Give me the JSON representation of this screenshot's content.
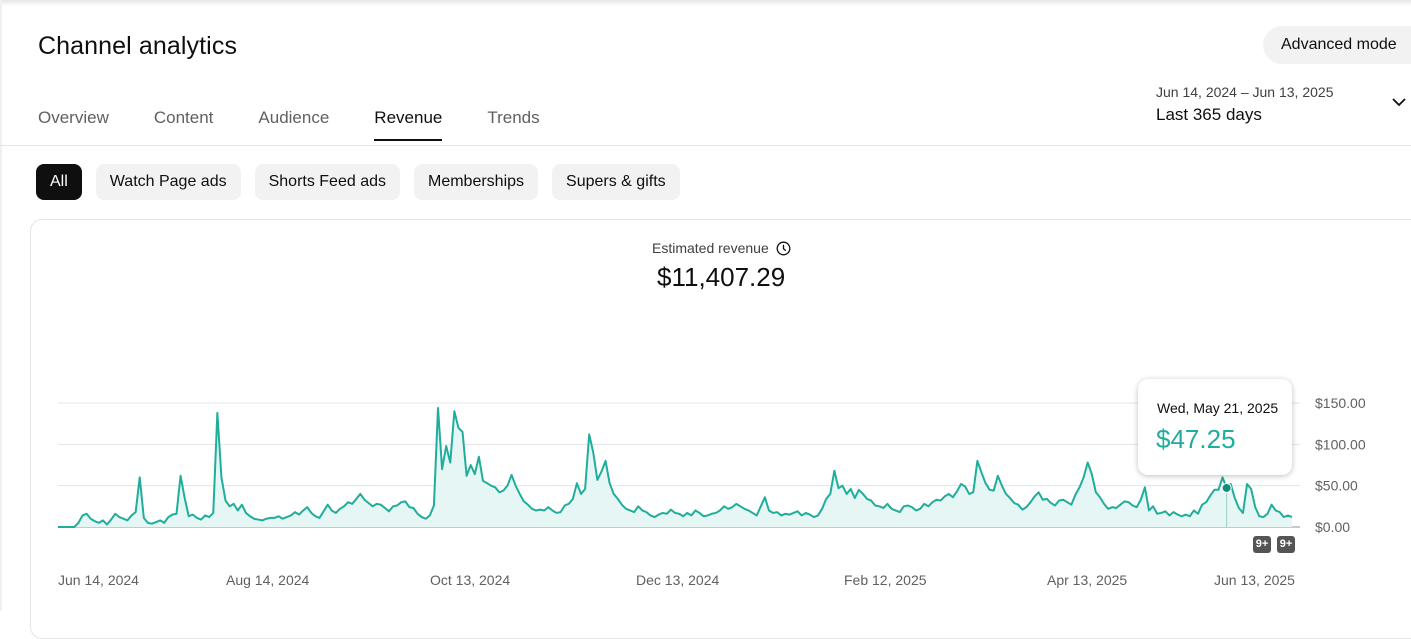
{
  "header": {
    "title": "Channel analytics",
    "advanced_mode_label": "Advanced mode"
  },
  "tabs": [
    {
      "label": "Overview"
    },
    {
      "label": "Content"
    },
    {
      "label": "Audience"
    },
    {
      "label": "Revenue",
      "active": true
    },
    {
      "label": "Trends"
    }
  ],
  "date_range": {
    "dates": "Jun 14, 2024 – Jun 13, 2025",
    "period": "Last 365 days"
  },
  "filter_chips": [
    {
      "label": "All",
      "active": true
    },
    {
      "label": "Watch Page ads"
    },
    {
      "label": "Shorts Feed ads"
    },
    {
      "label": "Memberships"
    },
    {
      "label": "Supers & gifts"
    }
  ],
  "metric": {
    "label": "Estimated revenue",
    "value": "$11,407.29",
    "info_icon": "clock-icon"
  },
  "tooltip": {
    "date": "Wed, May 21, 2025",
    "value": "$47.25"
  },
  "badges": [
    "9+",
    "9+"
  ],
  "colors": {
    "series": "#1fae9b",
    "fill": "#e6f6f4",
    "active_chip": "#0f0f0f",
    "chip": "#f2f2f2"
  },
  "chart_data": {
    "type": "area",
    "title": "Estimated revenue",
    "x_start": "Jun 14, 2024",
    "x_end": "Jun 13, 2025",
    "x_ticks": [
      "Jun 14, 2024",
      "Aug 14, 2024",
      "Oct 13, 2024",
      "Dec 13, 2024",
      "Feb 12, 2025",
      "Apr 13, 2025",
      "Jun 13, 2025"
    ],
    "y_ticks": [
      "$0.00",
      "$50.00",
      "$100.00",
      "$150.00"
    ],
    "ylim": [
      0,
      150
    ],
    "grid": true,
    "highlight": {
      "date": "May 21, 2025",
      "value": 47.25
    },
    "series": [
      {
        "values": [
          0,
          0,
          0,
          0,
          0,
          5,
          14,
          16,
          10,
          7,
          5,
          8,
          3,
          9,
          16,
          12,
          10,
          8,
          14,
          18,
          60,
          11,
          5,
          4,
          6,
          8,
          5,
          12,
          15,
          16,
          62,
          35,
          13,
          15,
          11,
          9,
          14,
          12,
          17,
          138,
          60,
          32,
          25,
          28,
          20,
          27,
          17,
          13,
          10,
          9,
          8,
          10,
          11,
          11,
          13,
          10,
          12,
          14,
          18,
          15,
          20,
          24,
          17,
          13,
          11,
          19,
          27,
          20,
          17,
          22,
          25,
          30,
          28,
          34,
          40,
          33,
          29,
          25,
          28,
          27,
          23,
          19,
          25,
          26,
          30,
          31,
          24,
          23,
          16,
          12,
          10,
          14,
          26,
          144,
          70,
          98,
          78,
          140,
          120,
          115,
          62,
          75,
          64,
          85,
          56,
          53,
          50,
          48,
          42,
          44,
          50,
          63,
          50,
          40,
          31,
          27,
          22,
          20,
          21,
          20,
          24,
          20,
          17,
          18,
          26,
          28,
          34,
          53,
          40,
          46,
          112,
          90,
          57,
          67,
          80,
          53,
          40,
          34,
          27,
          22,
          20,
          18,
          25,
          20,
          18,
          14,
          12,
          15,
          17,
          16,
          21,
          17,
          16,
          13,
          17,
          14,
          20,
          17,
          13,
          14,
          16,
          17,
          20,
          25,
          22,
          24,
          28,
          25,
          22,
          20,
          17,
          14,
          25,
          36,
          20,
          17,
          18,
          14,
          16,
          15,
          17,
          19,
          14,
          17,
          15,
          12,
          14,
          22,
          34,
          40,
          68,
          47,
          50,
          40,
          46,
          35,
          45,
          40,
          34,
          32,
          26,
          25,
          23,
          28,
          22,
          20,
          18,
          25,
          26,
          24,
          20,
          22,
          28,
          25,
          30,
          33,
          32,
          37,
          40,
          36,
          43,
          52,
          49,
          40,
          42,
          80,
          66,
          53,
          45,
          44,
          62,
          50,
          40,
          35,
          29,
          27,
          21,
          24,
          30,
          37,
          42,
          33,
          34,
          29,
          26,
          32,
          33,
          30,
          27,
          39,
          48,
          60,
          78,
          64,
          42,
          36,
          28,
          22,
          24,
          23,
          27,
          31,
          30,
          26,
          24,
          33,
          48,
          20,
          25,
          16,
          17,
          19,
          14,
          18,
          15,
          13,
          15,
          13,
          20,
          16,
          27,
          30,
          38,
          45,
          45,
          60,
          47.25,
          52,
          35,
          23,
          17,
          52,
          46,
          24,
          13,
          12,
          16,
          27,
          20,
          18,
          12,
          14,
          12
        ]
      }
    ]
  }
}
